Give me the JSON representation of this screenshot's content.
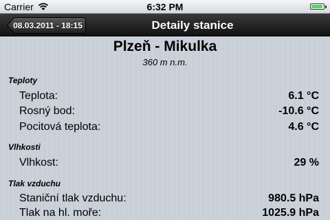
{
  "status": {
    "carrier": "Carrier",
    "time": "6:32 PM"
  },
  "nav": {
    "back_label": "08.03.2011 - 18:15",
    "title": "Detaily stanice"
  },
  "station": {
    "name": "Plzeň - Mikulka",
    "altitude": "360 m n.m."
  },
  "sections": {
    "temperature": {
      "title": "Teploty",
      "rows": [
        {
          "label": "Teplota:",
          "value": "6.1 °C"
        },
        {
          "label": "Rosný bod:",
          "value": "-10.6 °C"
        },
        {
          "label": "Pocitová teplota:",
          "value": "4.6 °C"
        }
      ]
    },
    "humidity": {
      "title": "Vlhkosti",
      "rows": [
        {
          "label": "Vlhkost:",
          "value": "29 %"
        }
      ]
    },
    "pressure": {
      "title": "Tlak vzduchu",
      "rows": [
        {
          "label": "Staniční tlak vzduchu:",
          "value": "980.5 hPa"
        },
        {
          "label": "Tlak na hl. moře:",
          "value": "1025.9 hPa"
        }
      ]
    }
  }
}
